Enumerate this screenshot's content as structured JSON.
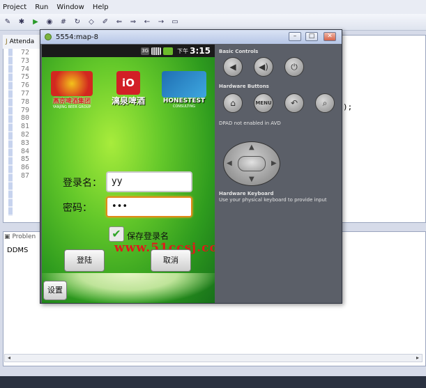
{
  "eclipse": {
    "menu": [
      "Project",
      "Run",
      "Window",
      "Help"
    ],
    "editor_tab": "Attenda",
    "line_numbers": [
      "72",
      "73",
      "74",
      "75",
      "76",
      "77",
      "78",
      "79",
      "80",
      "81",
      "82",
      "83",
      "84",
      "85",
      "86",
      "87"
    ],
    "code_tail": ");",
    "bottom_tab": "Problen",
    "ddms": "DDMS"
  },
  "emulator": {
    "title": "5554:map-8",
    "status_bar": {
      "network": "3G",
      "ampm": "下午",
      "time": "3:15"
    },
    "logos": {
      "yanjing_name": "燕京啤酒集团",
      "yanjing_sub": "YANJING BEER GROUP",
      "liquan_name": "漓泉啤酒",
      "honestest_name": "HONESTEST",
      "honestest_sub": "CONSULTING"
    },
    "login": {
      "username_label": "登录名：",
      "username_value": "yy",
      "password_label": "密码：",
      "password_value": "•••",
      "remember_label": "保存登录名",
      "remember_checked": true,
      "login_button": "登陆",
      "cancel_button": "取消",
      "settings_button": "设置"
    },
    "watermark": "www.51ccsj.com",
    "controls": {
      "basic_heading": "Basic Controls",
      "hardware_heading": "Hardware Buttons",
      "menu_label": "MENU",
      "dpad_note": "DPAD not enabled in AVD",
      "keyboard_heading": "Hardware Keyboard",
      "keyboard_text": "Use your physical keyboard to provide input"
    }
  },
  "colors": {
    "accent_focus": "#e08a1a",
    "watermark": "#e01a1a",
    "checkbox_check": "#2fa528"
  }
}
